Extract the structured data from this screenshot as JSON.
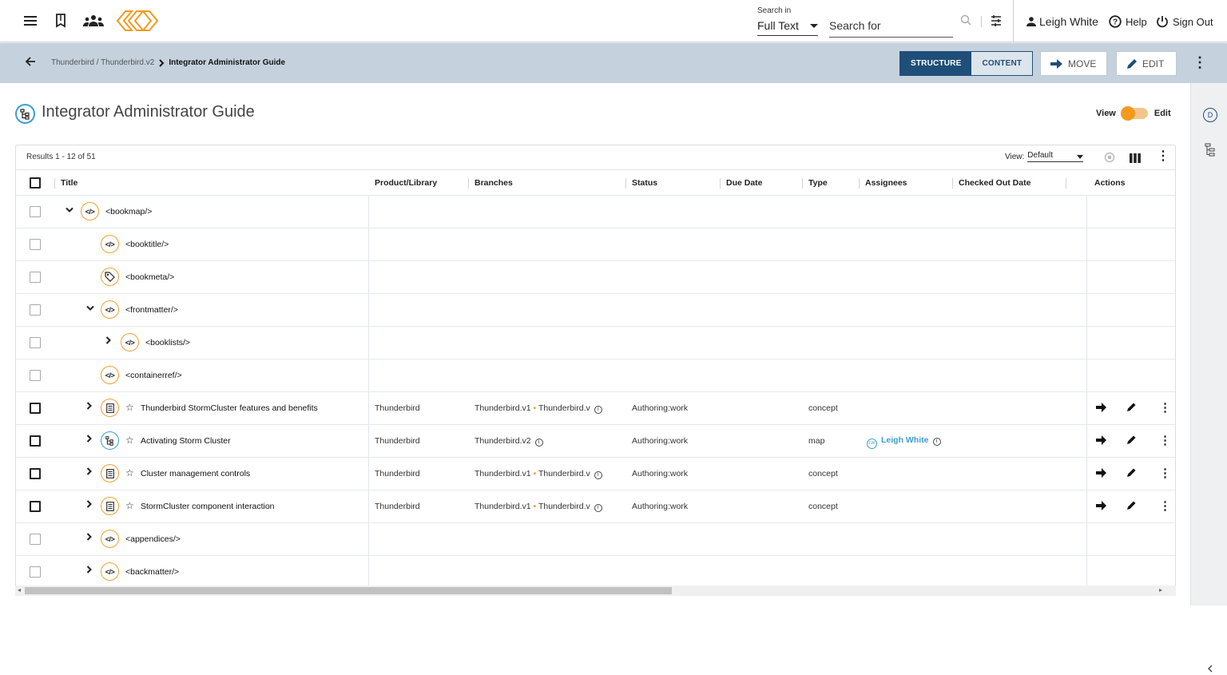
{
  "topbar": {
    "search_in_label": "Search in",
    "search_in_value": "Full Text",
    "search_for_placeholder": "Search for",
    "user_name": "Leigh White",
    "help_label": "Help",
    "signout_label": "Sign Out",
    "icons": [
      "menu-icon",
      "bookmark-icon",
      "groups-icon",
      "logo",
      "search-icon",
      "filter-settings-icon",
      "person-icon",
      "help-icon",
      "power-icon"
    ]
  },
  "subbar": {
    "breadcrumb_path": "Thunderbird / Thunderbird.v2",
    "breadcrumb_current": "Integrator Administrator Guide",
    "structure_label": "STRUCTURE",
    "content_label": "CONTENT",
    "move_label": "MOVE",
    "edit_label": "EDIT"
  },
  "page": {
    "title": "Integrator Administrator Guide",
    "view_label": "View",
    "edit_label": "Edit"
  },
  "rail": {
    "d_label": "D"
  },
  "table": {
    "results_text": "Results 1 - 12 of 51",
    "view_label": "View:",
    "view_value": "Default",
    "columns": [
      "Title",
      "Product/Library",
      "Branches",
      "Status",
      "Due Date",
      "Type",
      "Assignees",
      "Checked Out Date",
      "Actions"
    ],
    "rows": [
      {
        "title": "<bookmap/>",
        "icon": "code-icon",
        "chev": "down",
        "level": 0
      },
      {
        "title": "<booktitle/>",
        "icon": "code-icon",
        "chev": "",
        "level": 1
      },
      {
        "title": "<bookmeta/>",
        "icon": "tag-icon",
        "chev": "",
        "level": 1
      },
      {
        "title": "<frontmatter/>",
        "icon": "code-icon",
        "chev": "down",
        "level": 1
      },
      {
        "title": "<booklists/>",
        "icon": "code-icon",
        "chev": "right",
        "level": 2
      },
      {
        "title": "<containerref/>",
        "icon": "code-icon",
        "chev": "",
        "level": 1
      },
      {
        "title": "Thunderbird StormCluster features and benefits",
        "icon": "document-icon",
        "chev": "right",
        "level": 1,
        "product": "Thunderbird",
        "branch_a": "Thunderbird.v1",
        "branch_b": "Thunderbird.v",
        "status": "Authoring:work",
        "type": "concept",
        "assignee": ""
      },
      {
        "title": "Activating Storm Cluster",
        "icon": "map-icon",
        "chev": "right",
        "level": 1,
        "product": "Thunderbird",
        "branch_a": "Thunderbird.v2",
        "branch_b": "",
        "status": "Authoring:work",
        "type": "map",
        "assignee": "Leigh White",
        "assignee_initials": "LW"
      },
      {
        "title": "Cluster management controls",
        "icon": "document-icon",
        "chev": "right",
        "level": 1,
        "product": "Thunderbird",
        "branch_a": "Thunderbird.v1",
        "branch_b": "Thunderbird.v",
        "status": "Authoring:work",
        "type": "concept",
        "assignee": ""
      },
      {
        "title": "StormCluster component interaction",
        "icon": "document-icon",
        "chev": "right",
        "level": 1,
        "product": "Thunderbird",
        "branch_a": "Thunderbird.v1",
        "branch_b": "Thunderbird.v",
        "status": "Authoring:work",
        "type": "concept",
        "assignee": ""
      },
      {
        "title": "<appendices/>",
        "icon": "code-icon",
        "chev": "right",
        "level": 1
      },
      {
        "title": "<backmatter/>",
        "icon": "code-icon",
        "chev": "right",
        "level": 1
      }
    ]
  }
}
